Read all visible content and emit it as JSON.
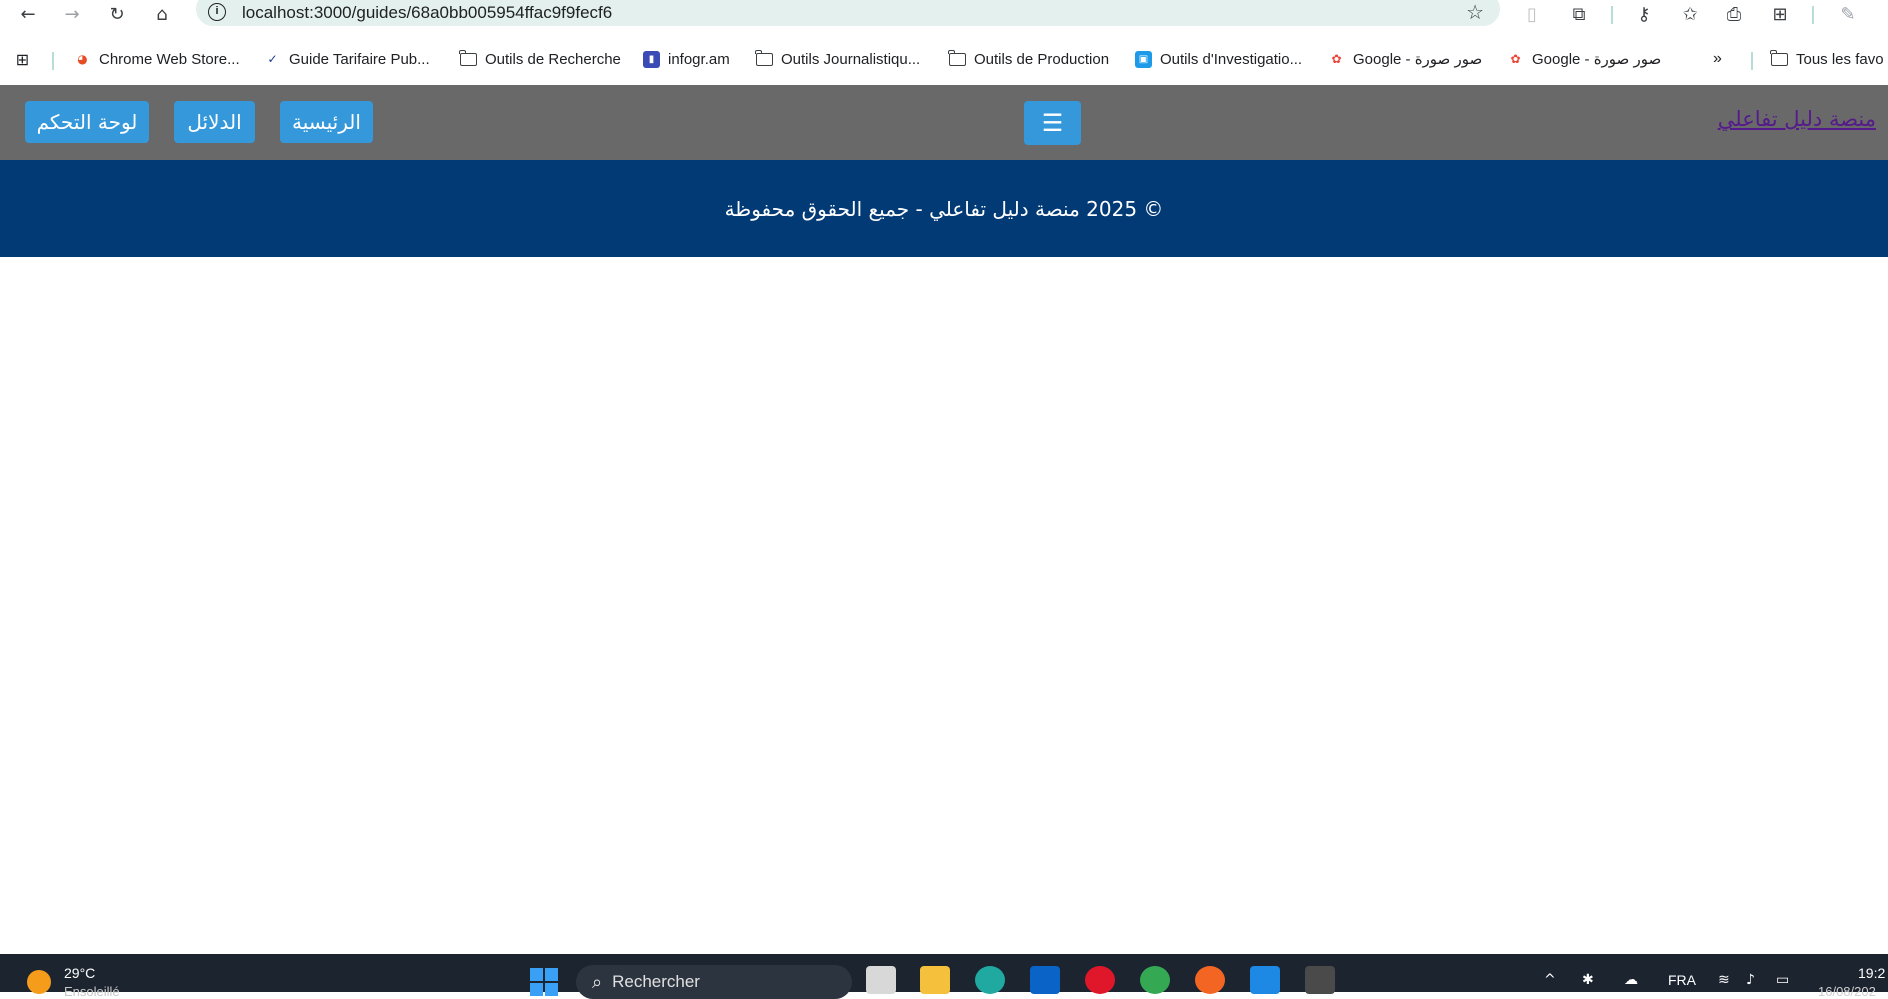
{
  "browser": {
    "url": "localhost:3000/guides/68a0bb005954ffac9f9fecf6",
    "bookmarks": [
      {
        "label": "Chrome Web Store..."
      },
      {
        "label": "Guide Tarifaire Pub..."
      },
      {
        "label": "Outils de Recherche"
      },
      {
        "label": "infogr.am"
      },
      {
        "label": "Outils Journalistiqu..."
      },
      {
        "label": "Outils de Production"
      },
      {
        "label": "Outils d'Investigatio..."
      },
      {
        "label": "Google - صور صورة"
      },
      {
        "label": "Google - صور صورة"
      }
    ],
    "all_bookmarks_label": "Tous les favo"
  },
  "navbar": {
    "brand": "منصة دليل تفاعلي",
    "menu_icon": "☰",
    "buttons": {
      "home": "الرئيسية",
      "guides": "الدلائل",
      "dashboard": "لوحة التحكم"
    }
  },
  "footer": {
    "text": "© 2025 منصة دليل تفاعلي - جميع الحقوق محفوظة"
  },
  "taskbar": {
    "weather_temp": "29°C",
    "weather_desc": "Ensoleillé",
    "search_placeholder": "Rechercher",
    "language": "FRA",
    "time": "19:2",
    "date": "16/08/202"
  },
  "colors": {
    "navbar_bg": "#696969",
    "button_bg": "#3498db",
    "footer_bg": "#023a75",
    "brand_link": "#551a8b"
  }
}
